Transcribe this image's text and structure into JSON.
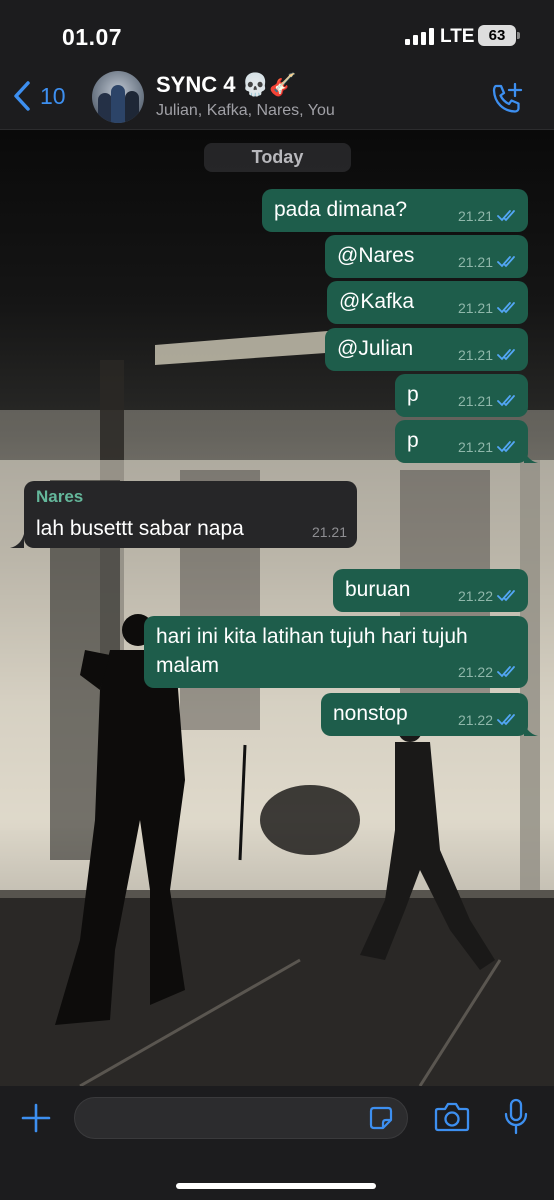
{
  "status_bar": {
    "time": "01.07",
    "network": "LTE",
    "battery": "63"
  },
  "header": {
    "back_count": "10",
    "group_name": "SYNC 4 💀🎸",
    "members": "Julian, Kafka, Nares, You"
  },
  "date_separator": "Today",
  "messages": [
    {
      "direction": "out",
      "text": "pada dimana?",
      "time": "21.21",
      "read": true
    },
    {
      "direction": "out",
      "text": "@Nares",
      "time": "21.21",
      "read": true
    },
    {
      "direction": "out",
      "text": "@Kafka",
      "time": "21.21",
      "read": true
    },
    {
      "direction": "out",
      "text": "@Julian",
      "time": "21.21",
      "read": true
    },
    {
      "direction": "out",
      "text": "p",
      "time": "21.21",
      "read": true
    },
    {
      "direction": "out",
      "text": "p",
      "time": "21.21",
      "read": true
    },
    {
      "direction": "in",
      "sender": "Nares",
      "text": "lah busettt sabar napa",
      "time": "21.21"
    },
    {
      "direction": "out",
      "text": "buruan",
      "time": "21.22",
      "read": true
    },
    {
      "direction": "out",
      "text_line1": "hari ini kita latihan tujuh hari tujuh",
      "text_line2": "malam",
      "time": "21.22",
      "read": true
    },
    {
      "direction": "out",
      "text": "nonstop",
      "time": "21.22",
      "read": true
    }
  ],
  "colors": {
    "outgoing_bubble": "#1e5d4b",
    "incoming_bubble": "#262628",
    "accent_blue": "#3d8ff0",
    "read_ticks": "#53a6f5",
    "sender_name": "#64b79b"
  },
  "icons": [
    "back-chevron-icon",
    "add-call-icon",
    "plus-icon",
    "sticker-icon",
    "camera-icon",
    "microphone-icon",
    "double-check-icon"
  ]
}
